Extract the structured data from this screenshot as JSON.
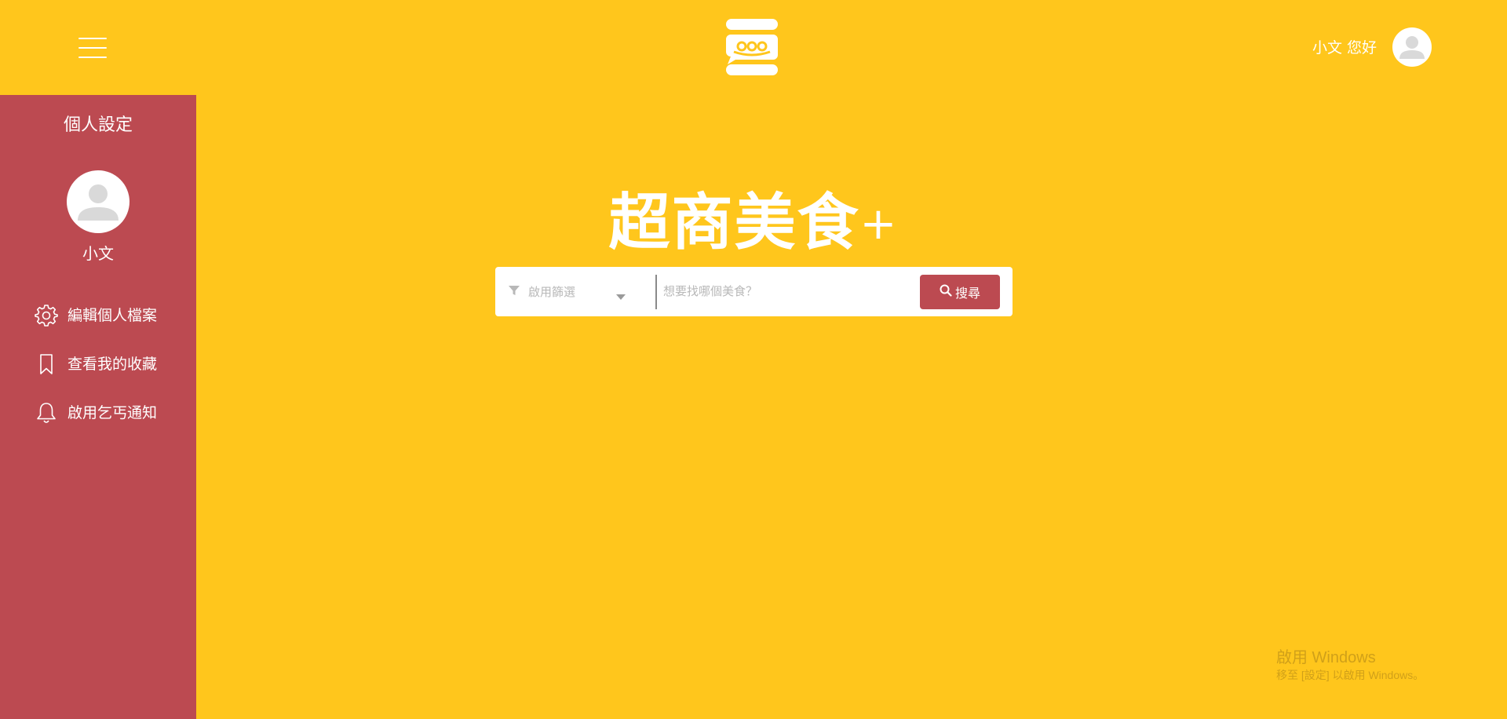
{
  "header": {
    "greeting": "小文 您好",
    "menu_icon": "hamburger-menu-icon",
    "logo_icon": "chat-bubble-logo-icon",
    "avatar_icon": "user-avatar-icon"
  },
  "sidebar": {
    "title": "個人設定",
    "username": "小文",
    "avatar_icon": "user-avatar-icon",
    "items": [
      {
        "label": "編輯個人檔案",
        "icon": "gear-icon"
      },
      {
        "label": "查看我的收藏",
        "icon": "bookmark-icon"
      },
      {
        "label": "啟用乞丐通知",
        "icon": "bell-icon"
      }
    ]
  },
  "hero": {
    "title": "超商美食",
    "title_suffix": "+"
  },
  "search": {
    "filter_label": "啟用篩選",
    "filter_icon": "filter-icon",
    "caret_icon": "caret-down-icon",
    "placeholder": "想要找哪個美食？",
    "value": "",
    "button_label": "搜尋",
    "button_icon": "search-icon"
  },
  "watermark": {
    "title": "啟用 Windows",
    "subtitle": "移至 [設定] 以啟用 Windows。"
  },
  "colors": {
    "background": "#FFC61C",
    "sidebar": "#BC4A51",
    "button": "#BC4A51",
    "text_light": "#FFFFFF"
  }
}
